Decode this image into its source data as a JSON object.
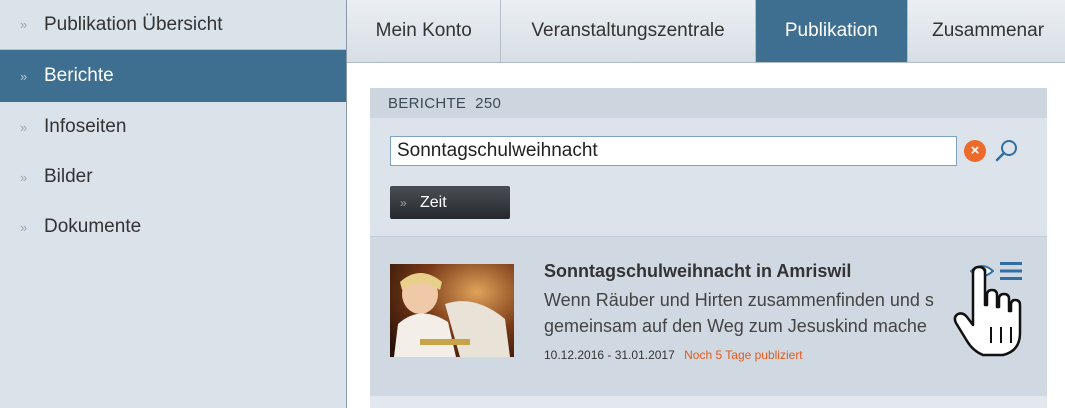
{
  "sidebar": {
    "items": [
      {
        "label": "Publikation Übersicht"
      },
      {
        "label": "Berichte"
      },
      {
        "label": "Infoseiten"
      },
      {
        "label": "Bilder"
      },
      {
        "label": "Dokumente"
      }
    ]
  },
  "tabs": [
    {
      "label": "Mein Konto"
    },
    {
      "label": "Veranstaltungszentrale"
    },
    {
      "label": "Publikation"
    },
    {
      "label": "Zusammenar"
    }
  ],
  "panel": {
    "heading": "BERICHTE  250",
    "search": {
      "value": "Sonntagschulweihnacht",
      "placeholder": ""
    },
    "zeit_label": "Zeit"
  },
  "result": {
    "title": "Sonntagschulweihnacht in Amriswil",
    "desc_line1": "Wenn Räuber und Hirten zusammenfinden und s",
    "desc_line2": "gemeinsam auf den Weg zum Jesuskind mache",
    "dates": "10.12.2016 - 31.01.2017",
    "status": "Noch 5 Tage publiziert"
  },
  "colors": {
    "accent": "#3e6e90",
    "status": "#e45a1c",
    "clear": "#ec6a2b"
  },
  "icons": [
    "chevron-icon",
    "clear-icon",
    "search-icon",
    "eye-icon",
    "menu-icon",
    "hand-cursor-icon"
  ]
}
